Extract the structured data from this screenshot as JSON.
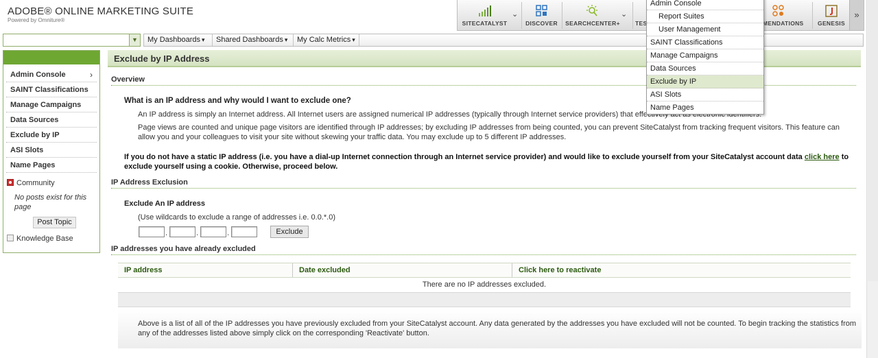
{
  "header": {
    "suite_title": "ADOBE® ONLINE MARKETING SUITE",
    "suite_subtitle": "Powered by Omniture®",
    "apps": [
      {
        "label": "SITECATALYST",
        "icon": "sitecatalyst-bars-icon"
      },
      {
        "label": "DISCOVER",
        "icon": "discover-grid-icon"
      },
      {
        "label": "SEARCHCENTER+",
        "icon": "searchcenter-sun-icon"
      },
      {
        "label": "TEST",
        "icon": "test-icon"
      },
      {
        "label": "MENDATIONS",
        "icon": "recommendations-icon"
      },
      {
        "label": "GENESIS",
        "icon": "genesis-icon"
      }
    ],
    "colors": {
      "accent": "#6fa733",
      "link": "#2c5a10"
    }
  },
  "nav": {
    "search_value": "",
    "items": [
      "My Dashboards",
      "Shared Dashboards",
      "My Calc Metrics"
    ]
  },
  "sidebar": {
    "items": [
      {
        "label": "Admin Console",
        "has_arrow": true
      },
      {
        "label": "SAINT Classifications"
      },
      {
        "label": "Manage Campaigns"
      },
      {
        "label": "Data Sources"
      },
      {
        "label": "Exclude by IP"
      },
      {
        "label": "ASI Slots"
      },
      {
        "label": "Name Pages"
      }
    ],
    "community_label": "Community",
    "no_posts": "No posts exist for this page",
    "post_button": "Post Topic",
    "knowledge_base": "Knowledge Base"
  },
  "main": {
    "title": "Exclude by IP Address",
    "overview_heading": "Overview",
    "question": "What is an IP address and why would I want to exclude one?",
    "para1": "An IP address is simply an Internet address. All Internet users are assigned numerical IP addresses (typically through Internet service providers) that effectively act as electronic identifiers.",
    "para2": "Page views are counted and unique page visitors are identified through IP addresses; by excluding IP addresses from being counted, you can prevent SiteCatalyst from tracking frequent visitors. This feature can allow you and your colleagues to visit your site without skewing your traffic data. You may exclude up to 5 different IP addresses.",
    "static_ip_text": "If you do not have a static IP address (i.e. you have a dial-up Internet connection through an Internet service provider) and would like to exclude yourself from your SiteCatalyst account data",
    "click_here": "click here",
    "static_ip_text2": "to exclude yourself using a cookie. Otherwise, proceed below.",
    "ip_exclusion_heading": "IP Address Exclusion",
    "exclude_heading": "Exclude An IP address",
    "wildcard_hint": "(Use wildcards to exclude a range of addresses i.e. 0.0.*.0)",
    "ip_octets": [
      "",
      "",
      "",
      ""
    ],
    "exclude_button": "Exclude",
    "excluded_heading": "IP addresses you have already excluded",
    "table": {
      "columns": [
        "IP address",
        "Date excluded",
        "Click here to reactivate"
      ],
      "empty_message": "There are no IP addresses excluded."
    },
    "footnote": "Above is a list of all of the IP addresses you have previously excluded from your SiteCatalyst account. Any data generated by the addresses you have excluded will not be counted. To begin tracking the statistics from any of the addresses listed above simply click on the corresponding 'Reactivate' button."
  },
  "dropdown": {
    "items": [
      {
        "label": "Admin Console",
        "level": 0
      },
      {
        "label": "Report Suites",
        "level": 1
      },
      {
        "label": "User Management",
        "level": 1
      },
      {
        "label": "SAINT Classifications",
        "level": 0
      },
      {
        "label": "Manage Campaigns",
        "level": 0
      },
      {
        "label": "Data Sources",
        "level": 0
      },
      {
        "label": "Exclude by IP",
        "level": 0,
        "active": true
      },
      {
        "label": "ASI Slots",
        "level": 0
      },
      {
        "label": "Name Pages",
        "level": 0
      }
    ]
  }
}
